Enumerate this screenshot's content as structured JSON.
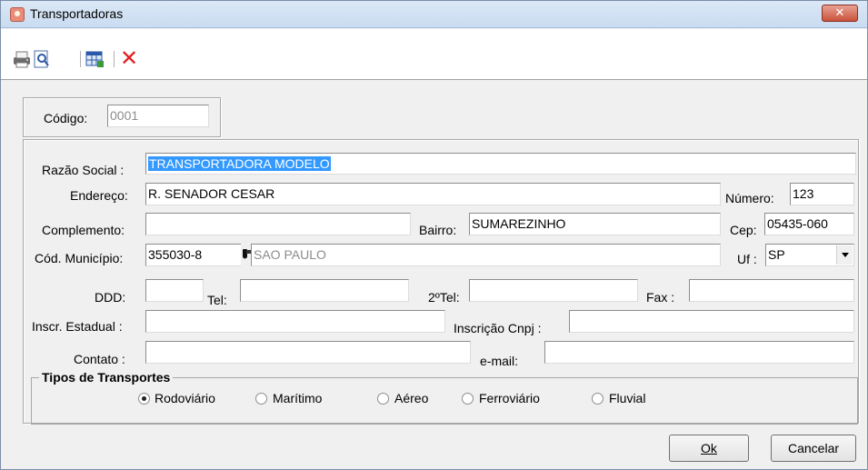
{
  "window": {
    "title": "Transportadoras",
    "close_label": "✕"
  },
  "toolbar": {
    "print_icon": "printer-icon",
    "preview_icon": "print-preview-icon",
    "grid_icon": "grid-icon",
    "delete_icon": "delete-icon",
    "delete_label": "✕"
  },
  "form": {
    "codigo": {
      "label": "Código:",
      "value": "0001"
    },
    "razao_social": {
      "label": "Razão Social :",
      "value": "TRANSPORTADORA MODELO"
    },
    "endereco": {
      "label": "Endereço:",
      "value": "R. SENADOR CESAR"
    },
    "numero": {
      "label": "Número:",
      "value": "123"
    },
    "complemento": {
      "label": "Complemento:",
      "value": ""
    },
    "bairro": {
      "label": "Bairro:",
      "value": "SUMAREZINHO"
    },
    "cep": {
      "label": "Cep:",
      "value": "05435-060"
    },
    "cod_municipio": {
      "label": "Cód. Município:",
      "value": "355030-8",
      "city": "SAO PAULO"
    },
    "uf": {
      "label": "Uf :",
      "value": "SP"
    },
    "ddd": {
      "label": "DDD:",
      "value": ""
    },
    "tel": {
      "label": "Tel:",
      "value": ""
    },
    "tel2": {
      "label": "2ºTel:",
      "value": ""
    },
    "fax": {
      "label": "Fax :",
      "value": ""
    },
    "inscr_estadual": {
      "label": "Inscr. Estadual :",
      "value": ""
    },
    "inscricao_cnpj": {
      "label": "Inscrição Cnpj :",
      "value": ""
    },
    "contato": {
      "label": "Contato :",
      "value": ""
    },
    "email": {
      "label": "e-mail:",
      "value": ""
    }
  },
  "tipos_transportes": {
    "legend": "Tipos de Transportes",
    "options": [
      "Rodoviário",
      "Marítimo",
      "Aéreo",
      "Ferroviário",
      "Fluvial"
    ],
    "selected": "Rodoviário"
  },
  "buttons": {
    "ok": "Ok",
    "cancelar": "Cancelar"
  },
  "colors": {
    "selection": "#3399ff",
    "delete": "#e02020",
    "titlebar": "#c9dcf1"
  }
}
